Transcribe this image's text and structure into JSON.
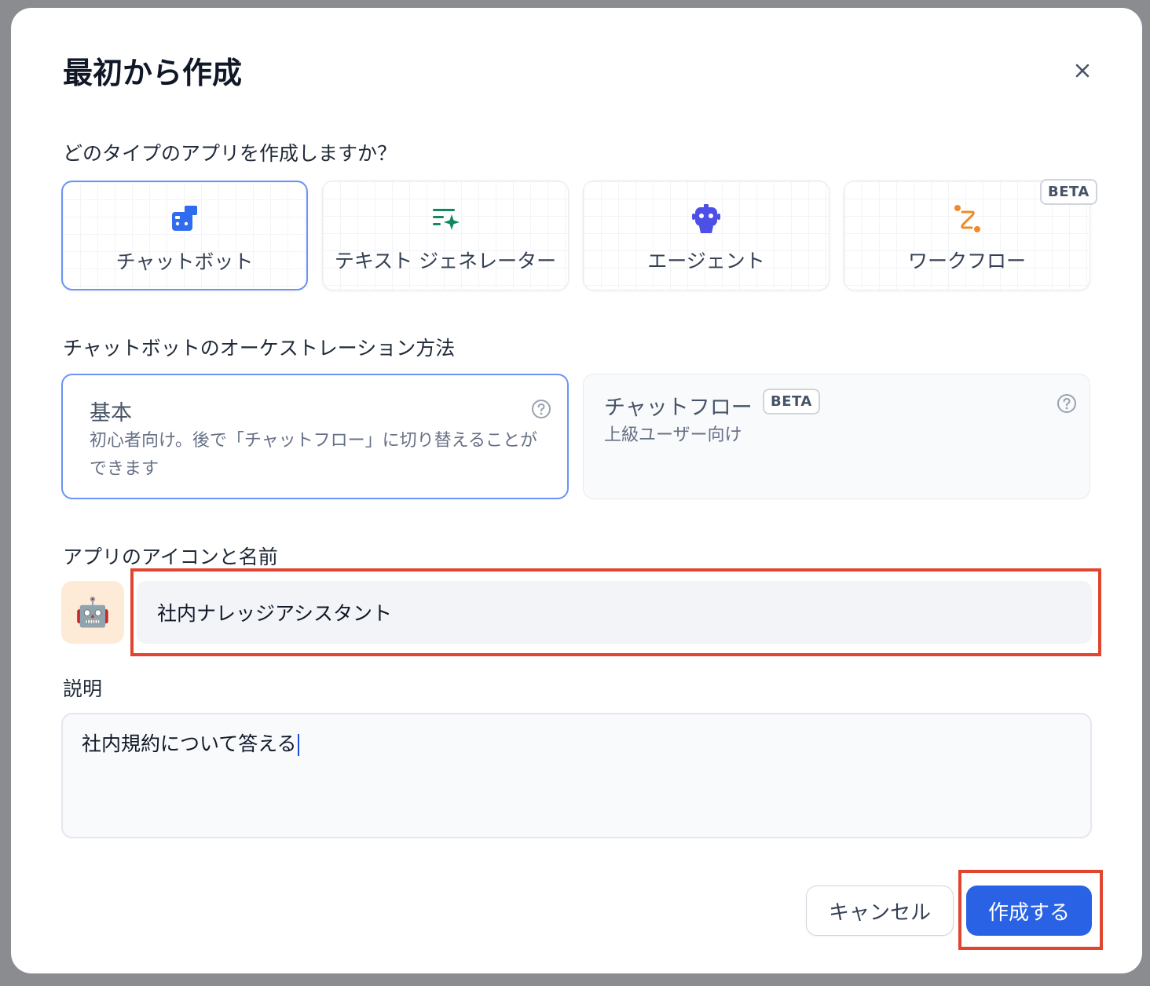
{
  "dialog": {
    "title": "最初から作成",
    "close_label": "×"
  },
  "app_type": {
    "question": "どのタイプのアプリを作成しますか？",
    "options": [
      {
        "label": "チャットボット",
        "icon": "chatbot-icon",
        "selected": true
      },
      {
        "label": "テキスト ジェネレーター",
        "icon": "text-generator-icon",
        "selected": false
      },
      {
        "label": "エージェント",
        "icon": "agent-icon",
        "selected": false
      },
      {
        "label": "ワークフロー",
        "icon": "workflow-icon",
        "selected": false,
        "badge": "BETA"
      }
    ]
  },
  "orchestration": {
    "label": "チャットボットのオーケストレーション方法",
    "options": [
      {
        "title": "基本",
        "desc": "初心者向け。後で「チャットフロー」に切り替えることができます",
        "selected": true
      },
      {
        "title": "チャットフロー",
        "badge": "BETA",
        "desc": "上級ユーザー向け",
        "selected": false
      }
    ]
  },
  "icon_name": {
    "label": "アプリのアイコンと名前",
    "emoji": "🤖",
    "name_value": "社内ナレッジアシスタント"
  },
  "description": {
    "label": "説明",
    "value": "社内規約について答える"
  },
  "footer": {
    "cancel_label": "キャンセル",
    "create_label": "作成する"
  },
  "colors": {
    "accent": "#2a62e6",
    "selected_border": "#6b93f5",
    "highlight": "#e0452f"
  }
}
